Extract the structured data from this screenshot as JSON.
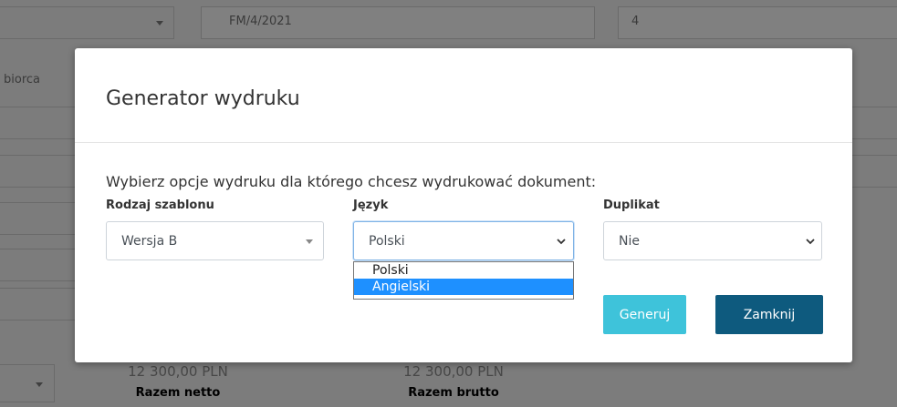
{
  "background": {
    "invoice_number": "FM/4/2021",
    "right_field_value": "4",
    "side_label": "biorca",
    "total_net": "12 300,00 PLN",
    "total_gross": "12 300,00 PLN",
    "total_net_label": "Razem netto",
    "total_gross_label": "Razem brutto"
  },
  "modal": {
    "title": "Generator wydruku",
    "intro": "Wybierz opcje wydruku dla którego chcesz wydrukować dokument:",
    "template": {
      "label": "Rodzaj szablonu",
      "value": "Wersja B"
    },
    "language": {
      "label": "Język",
      "value": "Polski",
      "options": [
        "Polski",
        "Angielski"
      ],
      "highlighted": "Angielski"
    },
    "duplicate": {
      "label": "Duplikat",
      "value": "Nie"
    },
    "buttons": {
      "generate": "Generuj",
      "close": "Zamknij"
    }
  },
  "colors": {
    "overlay": "#7c7c7c",
    "generate_button": "#3ec3da",
    "close_button": "#0e5a7e",
    "option_highlight": "#1e90ff",
    "focus_border": "#7fb3e6"
  }
}
